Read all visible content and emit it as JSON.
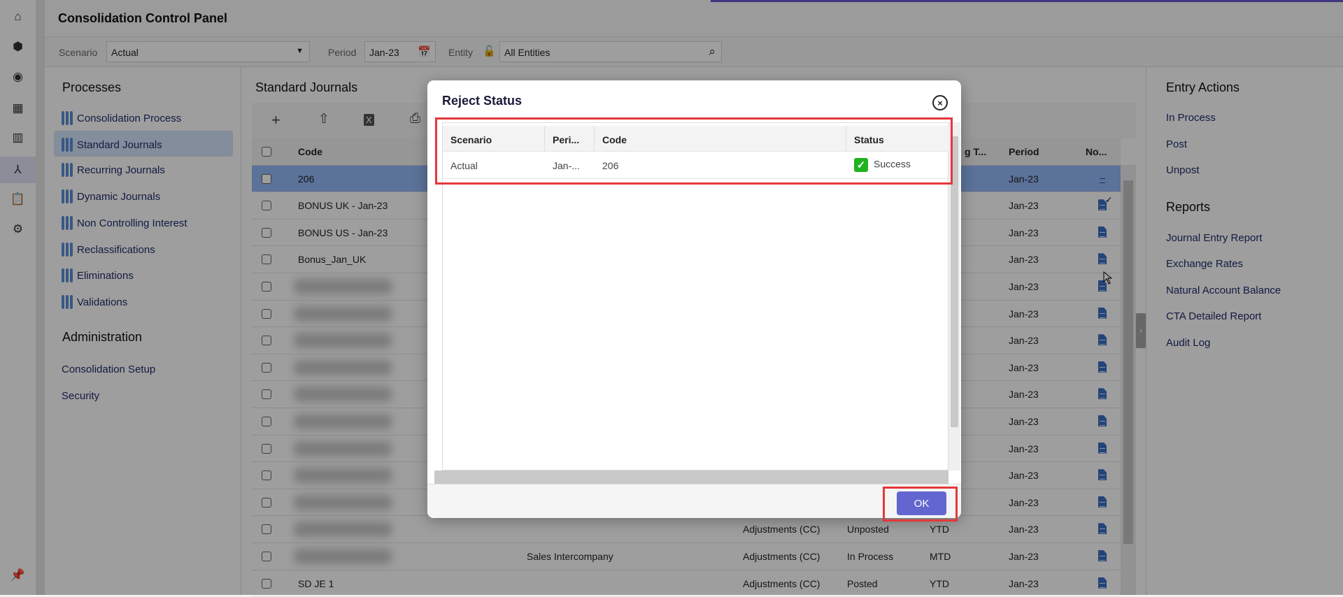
{
  "app": {
    "title": "Consolidation Control Panel"
  },
  "filters": {
    "scenario_label": "Scenario",
    "scenario_value": "Actual",
    "period_label": "Period",
    "period_value": "Jan-23",
    "entity_label": "Entity",
    "entity_value": "All Entities"
  },
  "rail": {
    "icons": [
      "home-icon",
      "cube-icon",
      "target-icon",
      "grid-icon",
      "report-icon",
      "hierarchy-icon",
      "clipboard-check-icon",
      "gear-icon"
    ],
    "selected": "hierarchy-icon",
    "pin_icon": "pin-icon"
  },
  "processes": {
    "heading": "Processes",
    "items": [
      "Consolidation Process",
      "Standard Journals",
      "Recurring Journals",
      "Dynamic Journals",
      "Non Controlling Interest",
      "Reclassifications",
      "Eliminations",
      "Validations"
    ],
    "selected": "Standard Journals"
  },
  "administration": {
    "heading": "Administration",
    "items": [
      "Consolidation Setup",
      "Security"
    ]
  },
  "journals": {
    "heading": "Standard Journals",
    "toolbar": [
      "add-icon",
      "upload-icon",
      "excel-icon",
      "print-icon"
    ],
    "columns": {
      "code": "Code",
      "gt": "g T...",
      "period": "Period",
      "notes": "No..."
    },
    "rows": [
      {
        "code": "206",
        "desc": "",
        "type": "",
        "status": "",
        "gt": "",
        "period": "Jan-23",
        "note": "lines"
      },
      {
        "code": "BONUS UK - Jan-23",
        "desc": "",
        "type": "",
        "status": "",
        "gt": "",
        "period": "Jan-23",
        "note": "check"
      },
      {
        "code": "BONUS US - Jan-23",
        "desc": "",
        "type": "",
        "status": "",
        "gt": "",
        "period": "Jan-23",
        "note": "doc"
      },
      {
        "code": "Bonus_Jan_UK",
        "desc": "",
        "type": "",
        "status": "",
        "gt": "",
        "period": "Jan-23",
        "note": "doc"
      },
      {
        "code": "",
        "desc": "",
        "type": "",
        "status": "",
        "gt": "",
        "period": "Jan-23",
        "note": "doc"
      },
      {
        "code": "",
        "desc": "",
        "type": "",
        "status": "",
        "gt": "",
        "period": "Jan-23",
        "note": "doc"
      },
      {
        "code": "",
        "desc": "",
        "type": "",
        "status": "",
        "gt": "",
        "period": "Jan-23",
        "note": "doc"
      },
      {
        "code": "",
        "desc": "",
        "type": "",
        "status": "",
        "gt": "",
        "period": "Jan-23",
        "note": "doc"
      },
      {
        "code": "",
        "desc": "",
        "type": "",
        "status": "",
        "gt": "",
        "period": "Jan-23",
        "note": "doc"
      },
      {
        "code": "",
        "desc": "",
        "type": "",
        "status": "",
        "gt": "",
        "period": "Jan-23",
        "note": "doc"
      },
      {
        "code": "",
        "desc": "",
        "type": "",
        "status": "",
        "gt": "",
        "period": "Jan-23",
        "note": "doc"
      },
      {
        "code": "",
        "desc": "",
        "type": "",
        "status": "",
        "gt": "",
        "period": "Jan-23",
        "note": "doc"
      },
      {
        "code": "",
        "desc": "",
        "type": "",
        "status": "",
        "gt": "",
        "period": "Jan-23",
        "note": "doc"
      },
      {
        "code": "",
        "desc": "",
        "type": "Adjustments (CC)",
        "status": "Unposted",
        "gt": "YTD",
        "period": "Jan-23",
        "note": "doc"
      },
      {
        "code": "",
        "desc": "Sales Intercompany",
        "type": "Adjustments (CC)",
        "status": "In Process",
        "gt": "MTD",
        "period": "Jan-23",
        "note": "doc"
      },
      {
        "code": "SD JE 1",
        "desc": "",
        "type": "Adjustments (CC)",
        "status": "Posted",
        "gt": "YTD",
        "period": "Jan-23",
        "note": "doc"
      }
    ],
    "selected_row": "206"
  },
  "entry_actions": {
    "heading": "Entry Actions",
    "items": [
      "In Process",
      "Post",
      "Unpost"
    ]
  },
  "reports": {
    "heading": "Reports",
    "items": [
      "Journal Entry Report",
      "Exchange Rates",
      "Natural Account Balance",
      "CTA Detailed Report",
      "Audit Log"
    ]
  },
  "dialog": {
    "title": "Reject Status",
    "columns": {
      "scenario": "Scenario",
      "period": "Peri...",
      "code": "Code",
      "status": "Status"
    },
    "rows": [
      {
        "scenario": "Actual",
        "period": "Jan-...",
        "code": "206",
        "status": "Success"
      }
    ],
    "ok_label": "OK"
  },
  "colors": {
    "accent": "#6366d1",
    "highlight": "#e5383b",
    "success": "#1fb31f",
    "progress": "#6a5acd"
  }
}
